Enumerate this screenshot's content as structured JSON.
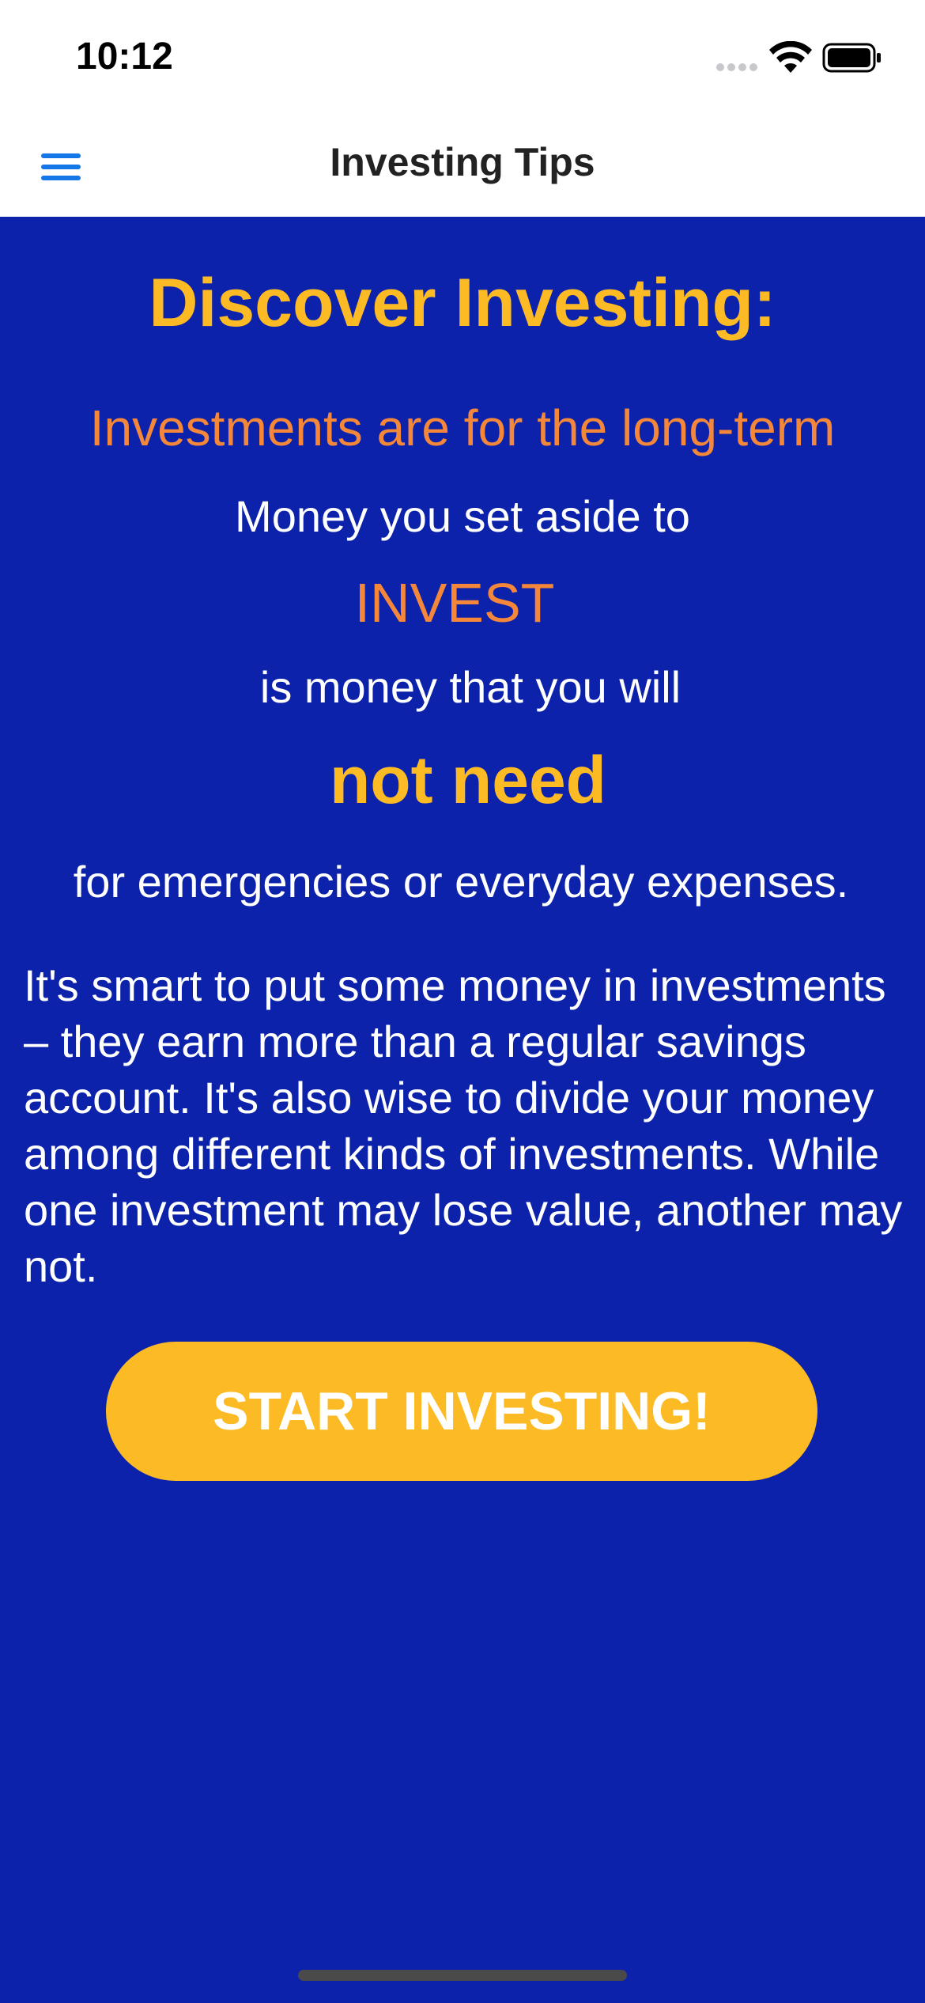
{
  "status_bar": {
    "time": "10:12"
  },
  "nav": {
    "title": "Investing Tips",
    "menu_icon": "hamburger-menu-icon"
  },
  "content": {
    "headline": "Discover Investing:",
    "subhead": "Investments are for the long-term",
    "line1": "Money you set aside to",
    "invest_word": "INVEST",
    "line2": "is money that you will",
    "emphasis": "not need",
    "line3": "for emergencies or everyday expenses.",
    "paragraph": "It's smart to put some money in investments – they earn more than a regular savings account. It's also wise to divide your money among different kinds of investments. While one investment may lose value, another may not.",
    "cta_label": "START INVESTING!"
  },
  "colors": {
    "background": "#0C22AA",
    "accent_yellow": "#FCBB25",
    "accent_orange": "#F5873A",
    "menu_blue": "#1576E8"
  }
}
